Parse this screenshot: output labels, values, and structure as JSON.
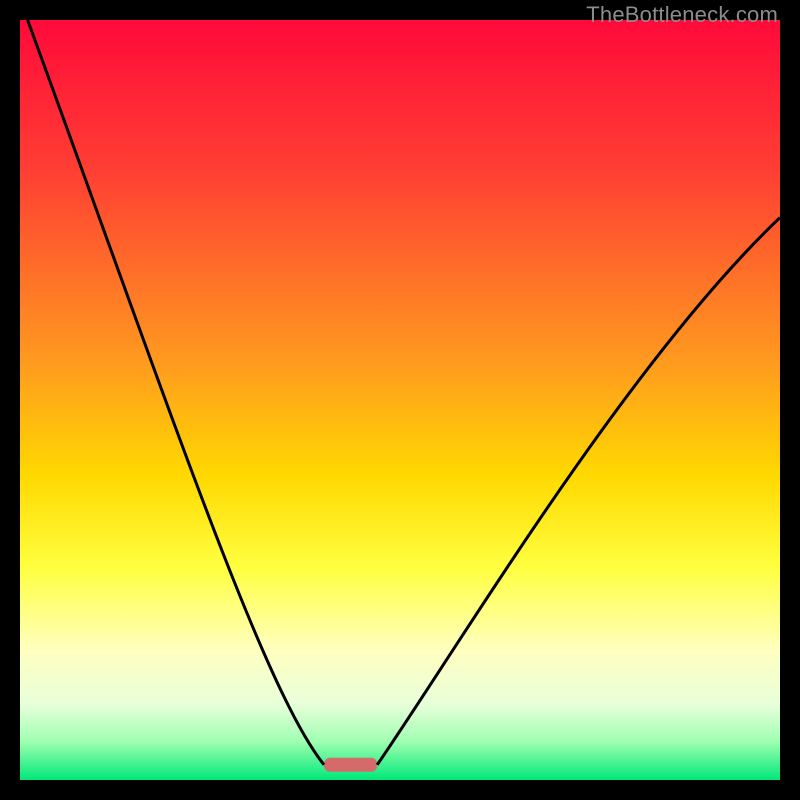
{
  "watermark": "TheBottleneck.com",
  "chart_data": {
    "type": "line",
    "title": "",
    "xlabel": "",
    "ylabel": "",
    "xlim": [
      0,
      100
    ],
    "ylim": [
      0,
      100
    ],
    "background_gradient": {
      "stops": [
        {
          "offset": 0,
          "color": "#ff0a3a"
        },
        {
          "offset": 20,
          "color": "#ff3f33"
        },
        {
          "offset": 45,
          "color": "#ff9a1f"
        },
        {
          "offset": 60,
          "color": "#ffd900"
        },
        {
          "offset": 72,
          "color": "#ffff40"
        },
        {
          "offset": 83,
          "color": "#ffffc0"
        },
        {
          "offset": 90,
          "color": "#e8ffda"
        },
        {
          "offset": 95,
          "color": "#9dffb0"
        },
        {
          "offset": 100,
          "color": "#00e878"
        }
      ]
    },
    "series": [
      {
        "name": "left-curve",
        "type": "cubic",
        "description": "falling convex curve from top-left to valley",
        "start": {
          "x": 1,
          "y": 100
        },
        "c1": {
          "x": 20,
          "y": 48
        },
        "c2": {
          "x": 32,
          "y": 12
        },
        "end": {
          "x": 40,
          "y": 2
        }
      },
      {
        "name": "right-curve",
        "type": "cubic",
        "description": "rising concave curve from valley toward upper-right",
        "start": {
          "x": 47,
          "y": 2
        },
        "c1": {
          "x": 58,
          "y": 18
        },
        "c2": {
          "x": 80,
          "y": 55
        },
        "end": {
          "x": 100,
          "y": 74
        }
      }
    ],
    "valley_marker": {
      "x": 40,
      "x2": 47,
      "y": 2,
      "color": "#d46a6a"
    }
  }
}
